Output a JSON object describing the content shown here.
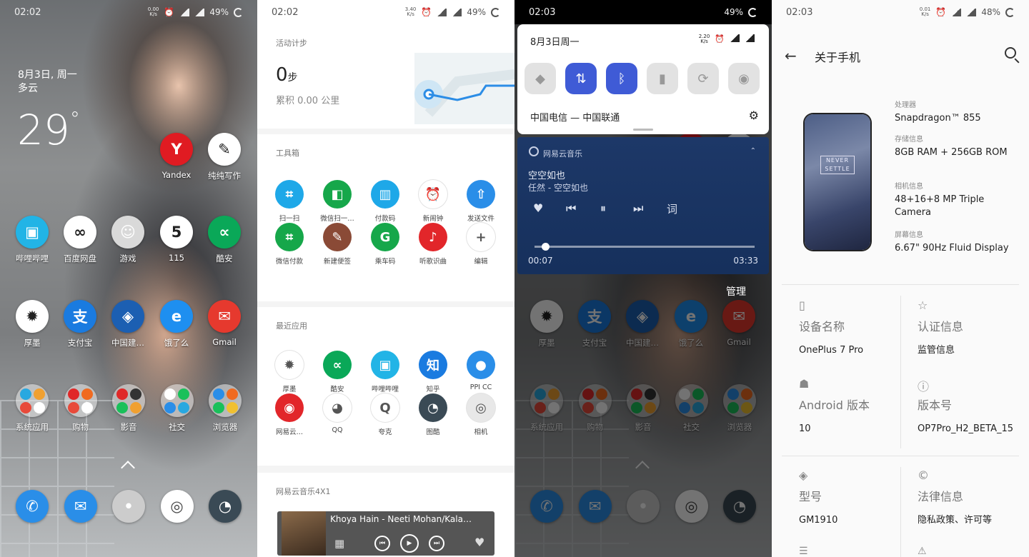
{
  "home": {
    "time": "02:02",
    "battery": "49%",
    "date_line": "8月3日, 周一",
    "weather": "多云",
    "temp": "29",
    "degree": "°",
    "apps": [
      {
        "label": "Yandex",
        "icon": "yandex-icon",
        "color": "#e01b22",
        "glyph": "Y"
      },
      {
        "label": "纯纯写作",
        "icon": "typewriter-icon",
        "color": "#ffffff",
        "glyph": "✎"
      },
      {
        "label": "哔哩哔哩",
        "icon": "bilibili-icon",
        "color": "#22b4e6",
        "glyph": "▣"
      },
      {
        "label": "百度网盘",
        "icon": "baidu-netdisk-icon",
        "color": "#ffffff",
        "glyph": "∞"
      },
      {
        "label": "游戏",
        "icon": "games-folder-icon",
        "color": "#d9d9d9",
        "glyph": "☺"
      },
      {
        "label": "115",
        "icon": "115-icon",
        "color": "#ffffff",
        "glyph": "5"
      },
      {
        "label": "酷安",
        "icon": "coolapk-icon",
        "color": "#0aa858",
        "glyph": "∝"
      },
      {
        "label": "厚墨",
        "icon": "houmo-icon",
        "color": "#ffffff",
        "glyph": "✹"
      },
      {
        "label": "支付宝",
        "icon": "alipay-icon",
        "color": "#1a7be0",
        "glyph": "支"
      },
      {
        "label": "中国建…",
        "icon": "ccb-icon",
        "color": "#1c5fb2",
        "glyph": "◈"
      },
      {
        "label": "饿了么",
        "icon": "eleme-icon",
        "color": "#1e8ff0",
        "glyph": "e"
      },
      {
        "label": "Gmail",
        "icon": "gmail-icon",
        "color": "#e6392e",
        "glyph": "✉"
      }
    ],
    "folders": [
      "系统应用",
      "购物",
      "影音",
      "社交",
      "浏览器"
    ],
    "dock": [
      {
        "icon": "phone-icon",
        "color": "#2a8ee8",
        "glyph": "✆"
      },
      {
        "icon": "messages-icon",
        "color": "#2a8ee8",
        "glyph": "✉"
      },
      {
        "icon": "folder-icon",
        "color": "#cccccc",
        "glyph": "•"
      },
      {
        "icon": "chrome-icon",
        "color": "#ffffff",
        "glyph": "◎"
      },
      {
        "icon": "camera-app-icon",
        "color": "#3a4a55",
        "glyph": "◔"
      }
    ]
  },
  "shelf": {
    "time": "02:02",
    "battery": "49%",
    "steps_title": "活动计步",
    "steps": "0",
    "steps_unit": "步",
    "distance": "累积 0.00 公里",
    "toolbox_title": "工具箱",
    "tools": [
      {
        "label": "扫一扫",
        "color": "#1ea8e8",
        "glyph": "⌗"
      },
      {
        "label": "微信扫一…",
        "color": "#16a74a",
        "glyph": "◧"
      },
      {
        "label": "付款码",
        "color": "#1ea8e8",
        "glyph": "▥"
      },
      {
        "label": "新闹钟",
        "color": "#ffffff",
        "glyph": "⏰"
      },
      {
        "label": "发送文件",
        "color": "#2a8ee8",
        "glyph": "⇧"
      },
      {
        "label": "微信付款",
        "color": "#16a74a",
        "glyph": "⌗"
      },
      {
        "label": "新建便签",
        "color": "#8a4a36",
        "glyph": "✎"
      },
      {
        "label": "乘车码",
        "color": "#16a74a",
        "glyph": "G"
      },
      {
        "label": "听歌识曲",
        "color": "#e2262a",
        "glyph": "♪"
      },
      {
        "label": "编辑",
        "color": "#ffffff",
        "glyph": "+"
      }
    ],
    "recent_title": "最近应用",
    "recent": [
      {
        "label": "厚墨",
        "color": "#ffffff",
        "glyph": "✹"
      },
      {
        "label": "酷安",
        "color": "#0aa858",
        "glyph": "∝"
      },
      {
        "label": "哔哩哔哩",
        "color": "#22b4e6",
        "glyph": "▣"
      },
      {
        "label": "知乎",
        "color": "#1a7be0",
        "glyph": "知"
      },
      {
        "label": "PPI CC",
        "color": "#2a8ee8",
        "glyph": "●"
      },
      {
        "label": "网易云…",
        "color": "#e2262a",
        "glyph": "◉"
      },
      {
        "label": "QQ",
        "color": "#ffffff",
        "glyph": "◕"
      },
      {
        "label": "夸克",
        "color": "#ffffff",
        "glyph": "Q"
      },
      {
        "label": "图酷",
        "color": "#3a4a55",
        "glyph": "◔"
      },
      {
        "label": "相机",
        "color": "#e8e8e8",
        "glyph": "◎"
      }
    ],
    "music_widget_title": "网易云音乐4X1",
    "music_widget_song": "Khoya Hain - Neeti Mohan/Kala…"
  },
  "notification": {
    "time": "02:03",
    "battery": "49%",
    "date": "8月3日周一",
    "carrier": "中国电信 — 中国联通",
    "tiles": [
      {
        "icon": "wifi-icon",
        "glyph": "◆",
        "on": false
      },
      {
        "icon": "mobile-data-icon",
        "glyph": "⇅",
        "on": true
      },
      {
        "icon": "bluetooth-icon",
        "glyph": "ᛒ",
        "on": true
      },
      {
        "icon": "flashlight-icon",
        "glyph": "▮",
        "on": false
      },
      {
        "icon": "auto-rotate-icon",
        "glyph": "⟳",
        "on": false
      },
      {
        "icon": "screen-record-icon",
        "glyph": "◉",
        "on": false
      }
    ],
    "music_app": "网易云音乐",
    "song": "空空如也",
    "artist": "任然 - 空空如也",
    "lyrics_label": "词",
    "elapsed": "00:07",
    "duration": "03:33",
    "progress": 0.033,
    "manage": "管理"
  },
  "about": {
    "time": "02:03",
    "battery": "48%",
    "title": "关于手机",
    "specs": [
      {
        "key": "处理器",
        "value": "Snapdragon™ 855"
      },
      {
        "key": "存储信息",
        "value": "8GB RAM + 256GB ROM"
      },
      {
        "key": "相机信息",
        "value": "48+16+8 MP Triple Camera"
      },
      {
        "key": "屏幕信息",
        "value": "6.67\" 90Hz Fluid Display"
      }
    ],
    "never_settle": "NEVER SETTLE",
    "device_name_key": "设备名称",
    "device_name": "OnePlus 7 Pro",
    "cert_key": "认证信息",
    "cert_value": "监管信息",
    "android_key": "Android 版本",
    "android_value": "10",
    "build_key": "版本号",
    "build_value": "OP7Pro_H2_BETA_15",
    "model_key": "型号",
    "model_value": "GM1910",
    "legal_key": "法律信息",
    "legal_value": "隐私政策、许可等"
  }
}
